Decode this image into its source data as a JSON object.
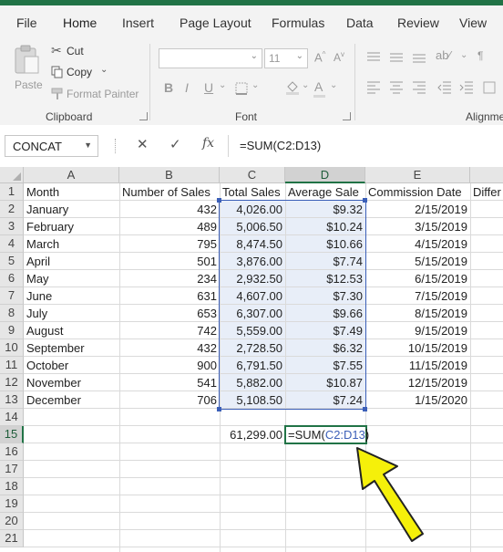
{
  "ribbon_tabs": [
    "File",
    "Home",
    "Insert",
    "Page Layout",
    "Formulas",
    "Data",
    "Review",
    "View"
  ],
  "clipboard": {
    "paste": "Paste",
    "cut": "Cut",
    "copy": "Copy",
    "format_painter": "Format Painter",
    "group_label": "Clipboard"
  },
  "font": {
    "size": "11",
    "bold": "B",
    "italic": "I",
    "underline": "U",
    "group_label": "Font"
  },
  "alignment": {
    "group_label": "Alignme"
  },
  "formula_bar": {
    "name_box": "CONCAT",
    "cancel": "✕",
    "enter": "✓",
    "fx": "fx",
    "formula": "=SUM(C2:D13)"
  },
  "columns": [
    "A",
    "B",
    "C",
    "D",
    "E"
  ],
  "row_numbers": [
    "1",
    "2",
    "3",
    "4",
    "5",
    "6",
    "7",
    "8",
    "9",
    "10",
    "11",
    "12",
    "13",
    "14",
    "15",
    "16",
    "17",
    "18",
    "19",
    "20",
    "21"
  ],
  "headers": {
    "a": "Month",
    "b": "Number of Sales",
    "c": "Total Sales",
    "d": "Average Sale",
    "e": "Commission Date",
    "f": "Differ"
  },
  "rows": [
    {
      "month": "January",
      "num": "432",
      "total": "4,026.00",
      "avg": "$9.32",
      "date": "2/15/2019"
    },
    {
      "month": "February",
      "num": "489",
      "total": "5,006.50",
      "avg": "$10.24",
      "date": "3/15/2019"
    },
    {
      "month": "March",
      "num": "795",
      "total": "8,474.50",
      "avg": "$10.66",
      "date": "4/15/2019"
    },
    {
      "month": "April",
      "num": "501",
      "total": "3,876.00",
      "avg": "$7.74",
      "date": "5/15/2019"
    },
    {
      "month": "May",
      "num": "234",
      "total": "2,932.50",
      "avg": "$12.53",
      "date": "6/15/2019"
    },
    {
      "month": "June",
      "num": "631",
      "total": "4,607.00",
      "avg": "$7.30",
      "date": "7/15/2019"
    },
    {
      "month": "July",
      "num": "653",
      "total": "6,307.00",
      "avg": "$9.66",
      "date": "8/15/2019"
    },
    {
      "month": "August",
      "num": "742",
      "total": "5,559.00",
      "avg": "$7.49",
      "date": "9/15/2019"
    },
    {
      "month": "September",
      "num": "432",
      "total": "2,728.50",
      "avg": "$6.32",
      "date": "10/15/2019"
    },
    {
      "month": "October",
      "num": "900",
      "total": "6,791.50",
      "avg": "$7.55",
      "date": "11/15/2019"
    },
    {
      "month": "November",
      "num": "541",
      "total": "5,882.00",
      "avg": "$10.87",
      "date": "12/15/2019"
    },
    {
      "month": "December",
      "num": "706",
      "total": "5,108.50",
      "avg": "$7.24",
      "date": "1/15/2020"
    }
  ],
  "row15": {
    "total": "61,299.00",
    "formula_prefix": "=SUM(",
    "formula_ref": "C2:D13",
    "formula_suffix": ")"
  },
  "colors": {
    "accent": "#217346",
    "range": "#3b5fb8",
    "arrow": "#f5f00a"
  }
}
